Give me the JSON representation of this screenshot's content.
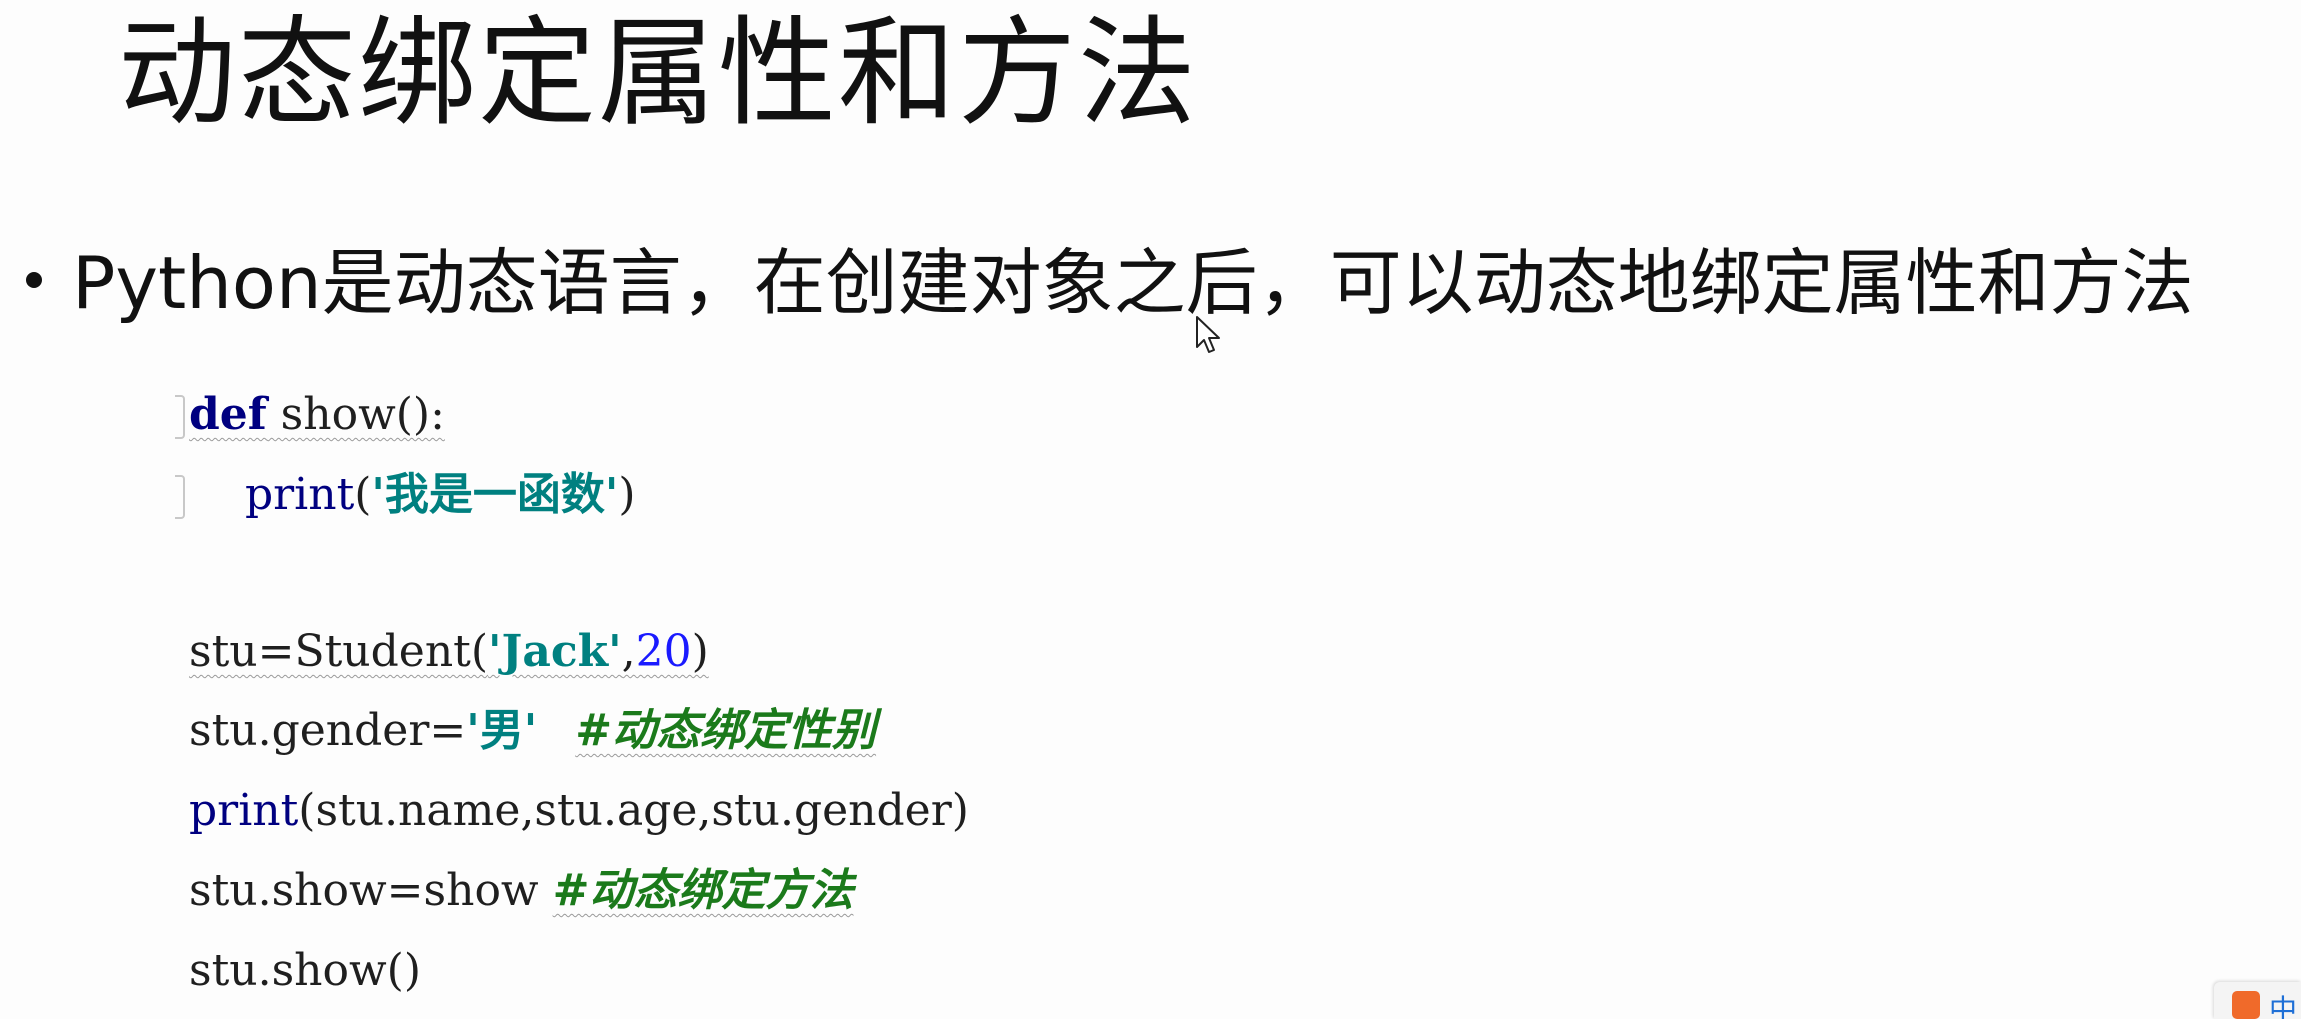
{
  "slide": {
    "title": "动态绑定属性和方法",
    "bullet_text": "Python是动态语言，在创建对象之后，可以动态地绑定属性和方法"
  },
  "code": {
    "line1": {
      "kw": "def",
      "rest": " show():"
    },
    "line2": {
      "indent": "    ",
      "func": "print",
      "open": "(",
      "str": "'我是一函数'",
      "close": ")"
    },
    "line3": {
      "pre": "stu=Student(",
      "str": "'Jack'",
      "comma": ",",
      "num": "20",
      "close": ")"
    },
    "line4": {
      "pre": "stu.gender=",
      "str": "'男'",
      "comment": "#动态绑定性别"
    },
    "line5": {
      "func": "print",
      "rest": "(stu.name,stu.age,stu.gender)"
    },
    "line6": {
      "pre": "stu.show=show ",
      "comment": "#动态绑定方法"
    },
    "line7": {
      "text": "stu.show()"
    }
  },
  "ime": {
    "label": "中"
  },
  "colors": {
    "keyword": "#000080",
    "string": "#008080",
    "number": "#1a1aff",
    "comment": "#1b7a1b"
  }
}
